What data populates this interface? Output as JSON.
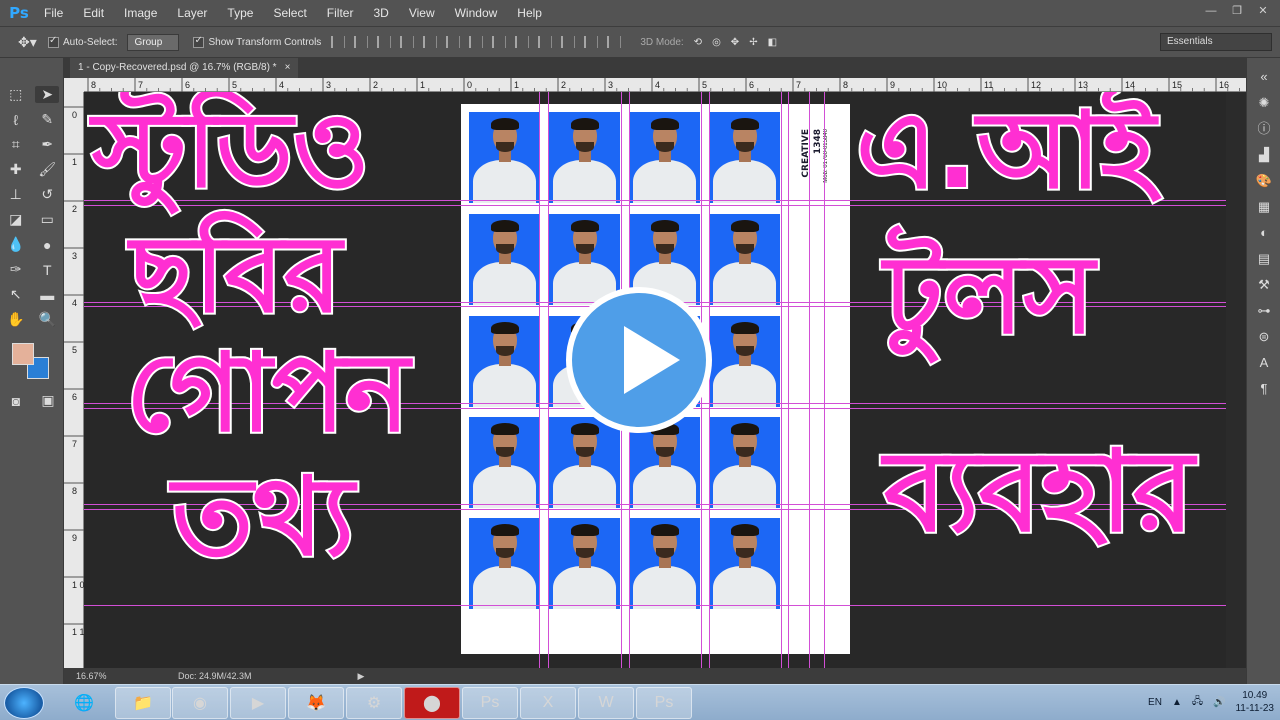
{
  "app": {
    "logo": "Ps",
    "menu": [
      "File",
      "Edit",
      "Image",
      "Layer",
      "Type",
      "Select",
      "Filter",
      "3D",
      "View",
      "Window",
      "Help"
    ]
  },
  "options": {
    "auto_select_label": "Auto-Select:",
    "auto_select_value": "Group",
    "transform_label": "Show Transform Controls",
    "mode_label": "3D Mode:",
    "workspace": "Essentials"
  },
  "document": {
    "tab_title": "1 - Copy-Recovered.psd @ 16.7% (RGB/8) *",
    "close": "×",
    "zoom": "16.67%",
    "doc_size": "Doc: 24.9M/42.3M"
  },
  "ruler": {
    "top": [
      "8",
      "7",
      "6",
      "5",
      "4",
      "3",
      "2",
      "1",
      "0",
      "1",
      "2",
      "3",
      "4",
      "5",
      "6",
      "7",
      "8",
      "9",
      "10",
      "11",
      "12",
      "13",
      "14",
      "15",
      "16"
    ],
    "left": [
      "0",
      "1",
      "2",
      "3",
      "4",
      "5",
      "6",
      "7",
      "8",
      "9",
      "1 0",
      "1 1"
    ]
  },
  "sheet": {
    "brand": "CREATIVE",
    "code": "1348",
    "mobile": "Mob: 01760-015840"
  },
  "overlay": {
    "left_lines": [
      "স্টুডিও",
      "ছবির",
      "গোপন",
      "তথ্য"
    ],
    "right_lines": [
      "এ.আই",
      "টুলস",
      "ব্যবহার"
    ]
  },
  "taskbar": {
    "lang": "EN",
    "time": "10.49",
    "date": "11-11-23"
  },
  "colors": {
    "overlay_text": "#ff2fd2",
    "guide": "#d24fd6",
    "photo_bg": "#1c67f5",
    "fg_swatch": "#e4b19a",
    "bg_swatch": "#2a7fd6"
  }
}
